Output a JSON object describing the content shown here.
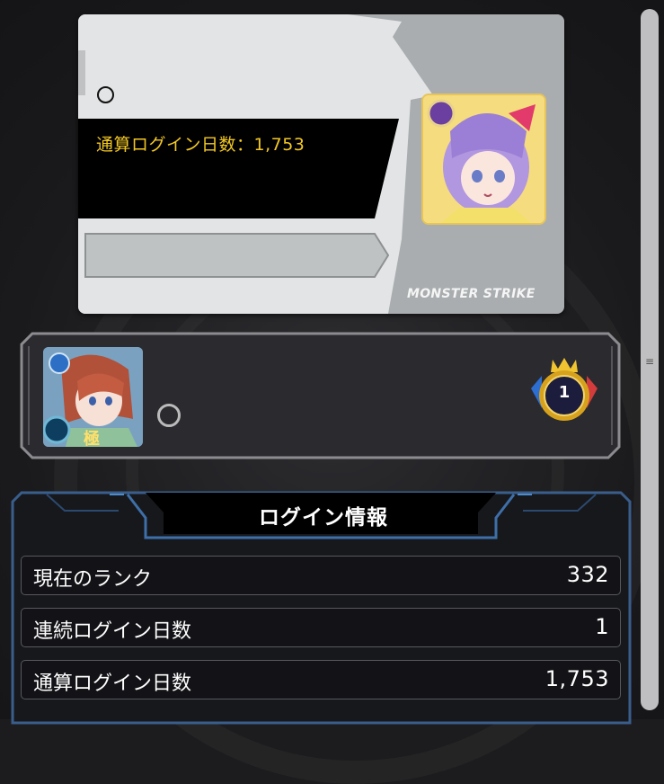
{
  "card": {
    "login_text": "通算ログイン日数：1,753",
    "brand": "MONSTER STRIKE"
  },
  "player": {
    "rank_badge_number": "1"
  },
  "info": {
    "title": "ログイン情報",
    "rows": [
      {
        "label": "現在のランク",
        "value": "332"
      },
      {
        "label": "連続ログイン日数",
        "value": "1"
      },
      {
        "label": "通算ログイン日数",
        "value": "1,753"
      }
    ]
  },
  "colors": {
    "card_bg": "#a9adaf",
    "login_text": "#f3c824",
    "panel_border": "#3a5e8c",
    "rank_badge_gold": "#d6a21e"
  }
}
